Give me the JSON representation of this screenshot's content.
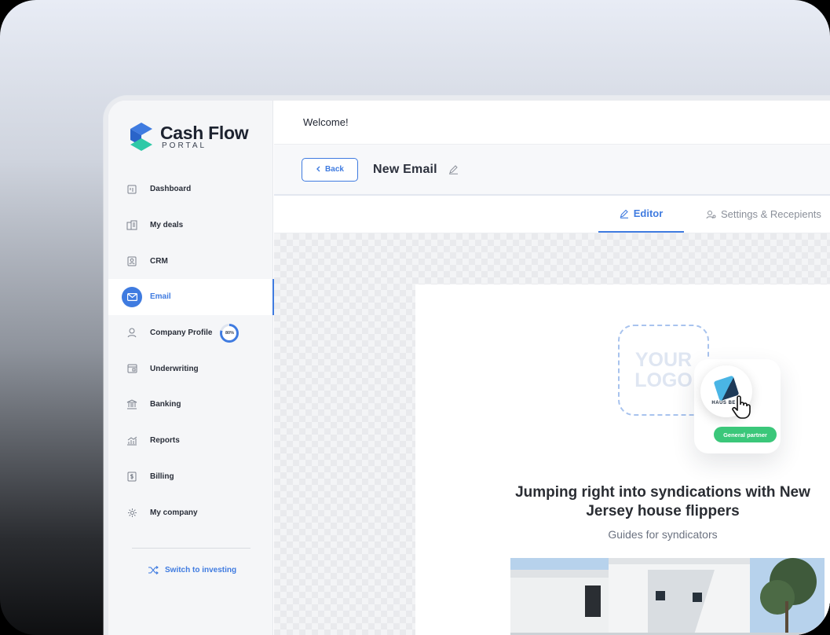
{
  "brand": {
    "name": "Cash Flow",
    "sub": "PORTAL",
    "color_primary": "#3f7be0",
    "color_teal": "#2ec9a7"
  },
  "sidebar": {
    "items": [
      {
        "label": "Dashboard",
        "icon": "dashboard-icon"
      },
      {
        "label": "My deals",
        "icon": "buildings-icon"
      },
      {
        "label": "CRM",
        "icon": "contact-card-icon"
      },
      {
        "label": "Email",
        "icon": "mail-icon",
        "active": true
      },
      {
        "label": "Company Profile",
        "icon": "user-icon",
        "progress": "80%"
      },
      {
        "label": "Underwriting",
        "icon": "calculator-icon"
      },
      {
        "label": "Banking",
        "icon": "bank-icon"
      },
      {
        "label": "Reports",
        "icon": "chart-icon"
      },
      {
        "label": "Billing",
        "icon": "dollar-doc-icon"
      },
      {
        "label": "My company",
        "icon": "gear-icon"
      }
    ],
    "switch_label": "Switch to investing"
  },
  "topbar": {
    "welcome": "Welcome!"
  },
  "subbar": {
    "back_label": "Back",
    "title": "New Email"
  },
  "tabs": {
    "editor": "Editor",
    "settings": "Settings & Recepients"
  },
  "email": {
    "logo_placeholder": "YOUR LOGO",
    "badge_text": "HAUS BE E",
    "partner_label": "General partner",
    "headline": "Jumping right into syndications with New Jersey house flippers",
    "subhead": "Guides for syndicators"
  }
}
